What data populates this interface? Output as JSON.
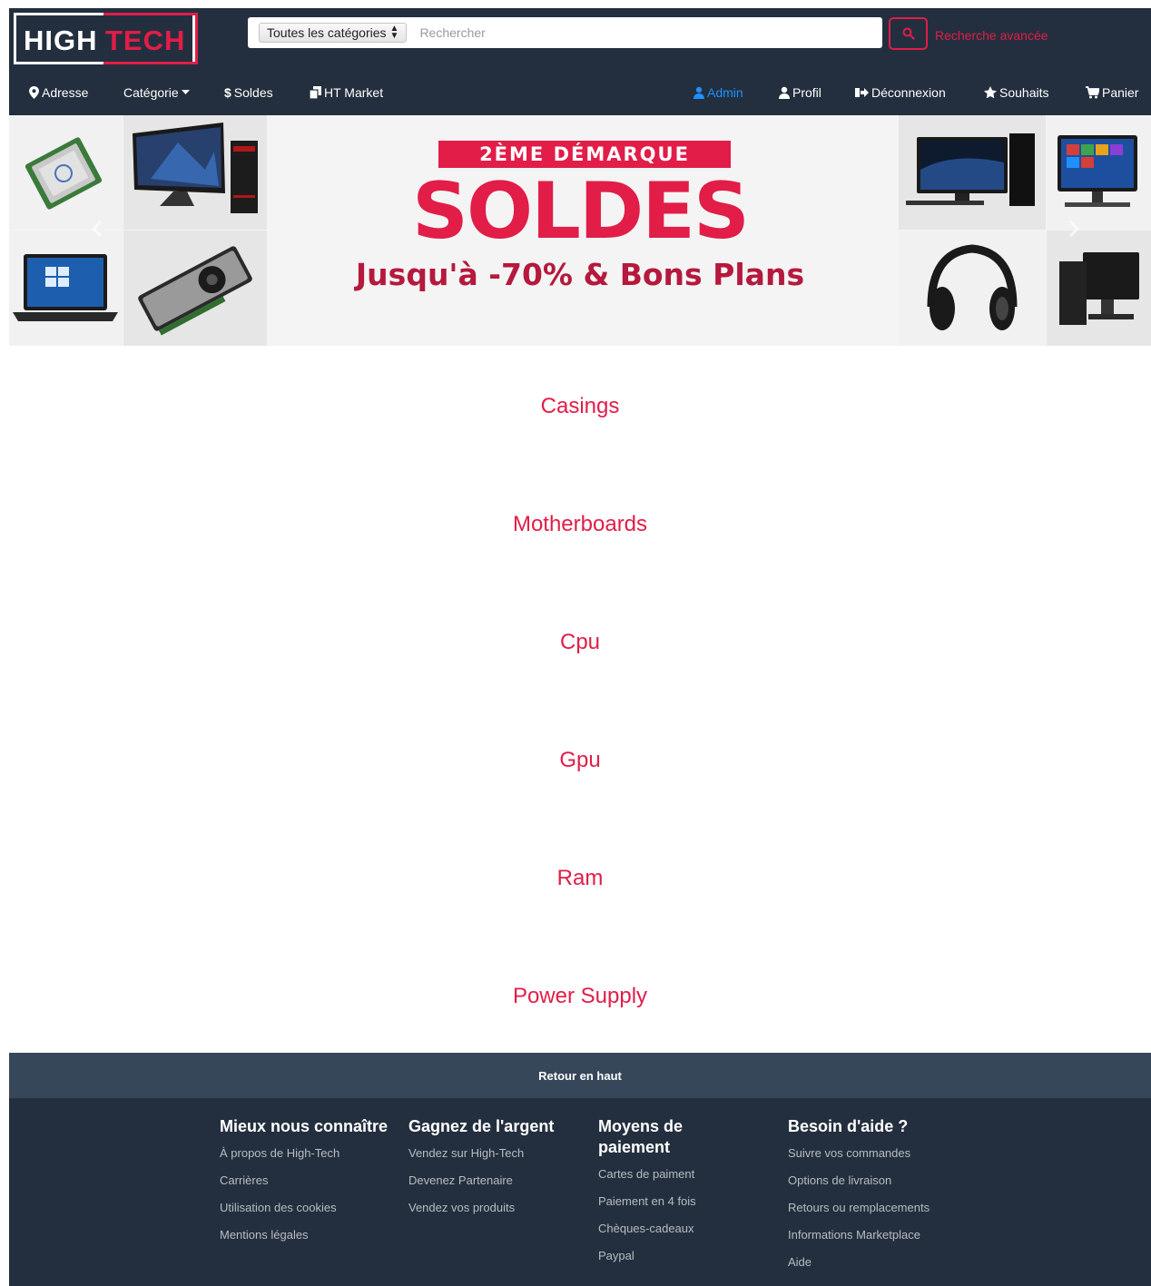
{
  "header": {
    "logo_white": "HIGH",
    "logo_red": "TECH",
    "category_select": "Toutes les catégories",
    "search_placeholder": "Rechercher",
    "advanced_search": "Recherche avancée"
  },
  "nav": {
    "left": [
      {
        "label": "Adresse",
        "icon": "map-marker-icon"
      },
      {
        "label": "Catégorie",
        "icon": "caret-down-icon"
      },
      {
        "label": "Soldes",
        "icon": "dollar-icon"
      },
      {
        "label": "HT Market",
        "icon": "copy-icon"
      }
    ],
    "right": [
      {
        "label": "Admin",
        "icon": "user-secret-icon"
      },
      {
        "label": "Profil",
        "icon": "user-icon"
      },
      {
        "label": "Déconnexion",
        "icon": "sign-out-icon"
      },
      {
        "label": "Souhaits",
        "icon": "star-icon"
      },
      {
        "label": "Panier",
        "icon": "cart-icon"
      }
    ]
  },
  "banner": {
    "tag": "2ÈME DÉMARQUE",
    "title": "SOLDES",
    "subtitle": "Jusqu'à -70% & Bons Plans",
    "images": [
      "cpu",
      "monitor-pc",
      "laptop",
      "gpu",
      "desktop-pc",
      "all-in-one-pc",
      "headphones",
      "desktop-pc-2"
    ]
  },
  "categories": [
    "Casings",
    "Motherboards",
    "Cpu",
    "Gpu",
    "Ram",
    "Power Supply"
  ],
  "footer": {
    "back_to_top": "Retour en haut",
    "columns": [
      {
        "title": "Mieux nous connaître",
        "links": [
          "À propos de High-Tech",
          "Carrières",
          "Utilisation des cookies",
          "Mentions légales"
        ]
      },
      {
        "title": "Gagnez de l'argent",
        "links": [
          "Vendez sur High-Tech",
          "Devenez Partenaire",
          "Vendez vos produits"
        ]
      },
      {
        "title": "Moyens de paiement",
        "links": [
          "Cartes de paiment",
          "Paiement en 4 fois",
          "Chèques-cadeaux",
          "Paypal"
        ]
      },
      {
        "title": "Besoin d'aide ?",
        "links": [
          "Suivre vos commandes",
          "Options de livraison",
          "Retours ou remplacements",
          "Informations Marketplace",
          "Aide"
        ]
      }
    ]
  },
  "colors": {
    "brand_red": "#e11d48",
    "header_bg": "#232f3e",
    "footer_top_bg": "#37475a",
    "admin_blue": "#1e90ff"
  }
}
